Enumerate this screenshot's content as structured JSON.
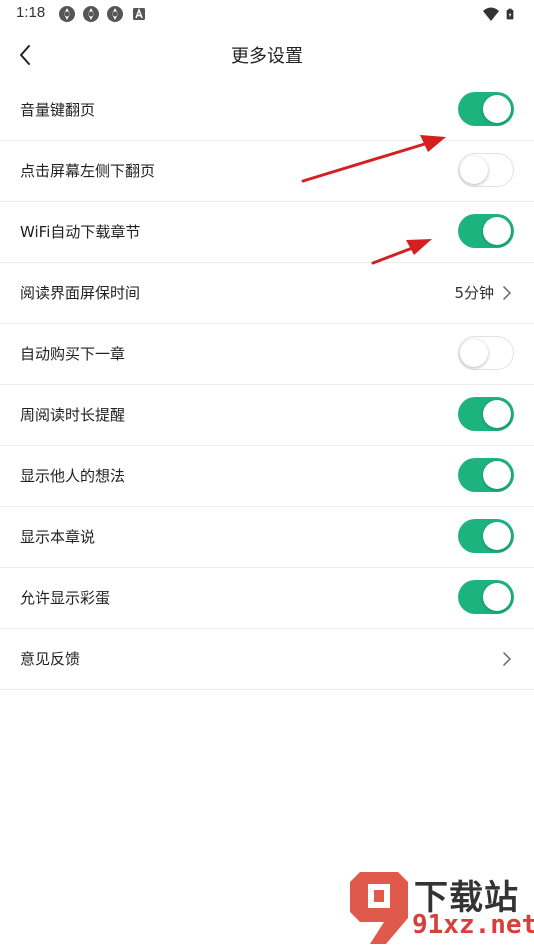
{
  "status_bar": {
    "time": "1:18",
    "left_icons": [
      "app-icon",
      "app-icon",
      "app-icon",
      "a-icon"
    ],
    "right_icons": [
      "wifi-icon",
      "battery-icon"
    ]
  },
  "nav": {
    "title": "更多设置",
    "back_icon": "chevron-left-icon"
  },
  "settings": [
    {
      "label": "音量键翻页",
      "type": "toggle",
      "on": true
    },
    {
      "label": "点击屏幕左侧下翻页",
      "type": "toggle",
      "on": false
    },
    {
      "label": "WiFi自动下载章节",
      "type": "toggle",
      "on": true
    },
    {
      "label": "阅读界面屏保时间",
      "type": "value",
      "value": "5分钟"
    },
    {
      "label": "自动购买下一章",
      "type": "toggle",
      "on": false
    },
    {
      "label": "周阅读时长提醒",
      "type": "toggle",
      "on": true
    },
    {
      "label": "显示他人的想法",
      "type": "toggle",
      "on": true
    },
    {
      "label": "显示本章说",
      "type": "toggle",
      "on": true
    },
    {
      "label": "允许显示彩蛋",
      "type": "toggle",
      "on": true
    },
    {
      "label": "意见反馈",
      "type": "link"
    }
  ],
  "colors": {
    "toggle_on": "#1db37e",
    "toggle_off_border": "#e2e2e2",
    "annotation": "#d42020"
  },
  "watermark": {
    "top": "下载站",
    "bottom": "91xz.net"
  }
}
